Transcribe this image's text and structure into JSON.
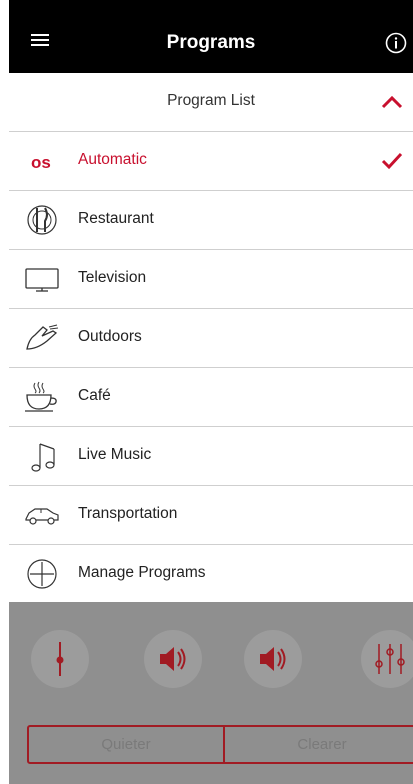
{
  "header": {
    "title": "Programs"
  },
  "list_header": {
    "label": "Program List"
  },
  "programs": [
    {
      "label": "Automatic",
      "icon": "automatic-os-icon",
      "selected": true
    },
    {
      "label": "Restaurant",
      "icon": "plate-cutlery-icon"
    },
    {
      "label": "Television",
      "icon": "television-icon"
    },
    {
      "label": "Outdoors",
      "icon": "sneaker-icon"
    },
    {
      "label": "Café",
      "icon": "coffee-cup-icon"
    },
    {
      "label": "Live Music",
      "icon": "music-note-icon"
    },
    {
      "label": "Transportation",
      "icon": "car-icon"
    },
    {
      "label": "Manage Programs",
      "icon": "plus-circle-icon"
    }
  ],
  "background": {
    "buttons": {
      "left": "Quieter",
      "right": "Clearer"
    }
  },
  "colors": {
    "accent": "#c8102e",
    "topbar": "#000000",
    "overlay": "#8f8f8f"
  }
}
